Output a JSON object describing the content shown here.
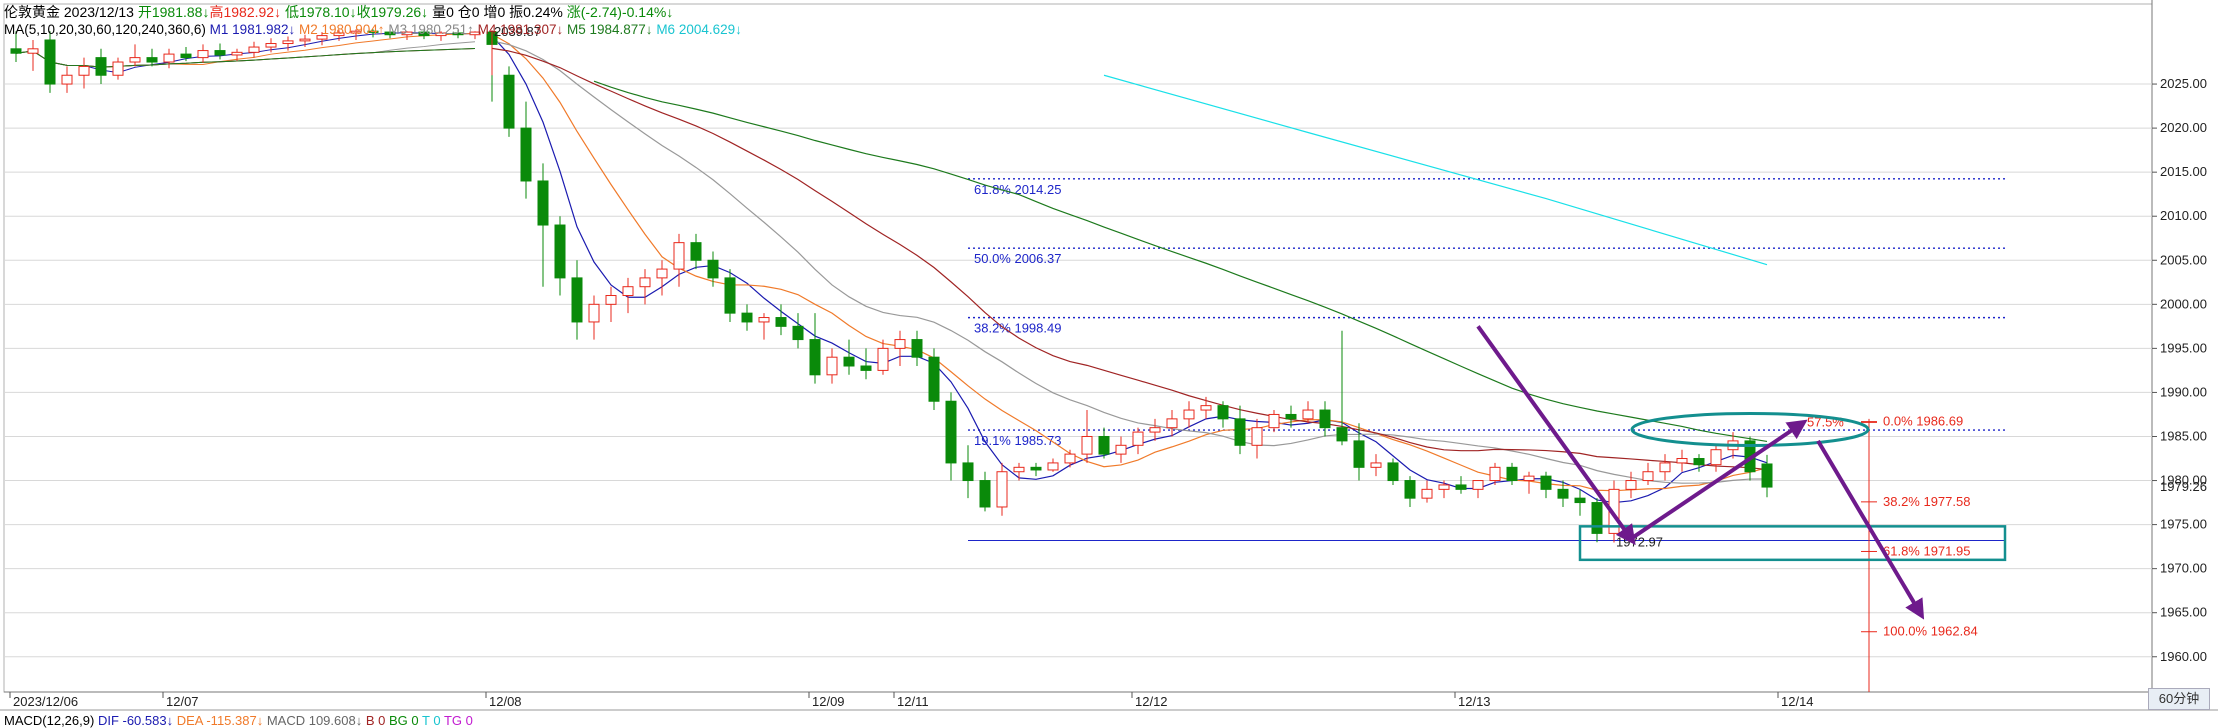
{
  "header": {
    "name": "伦敦黄金",
    "date": "2023/12/13",
    "open": "开1981.88↓",
    "high": "高1982.92↓",
    "low": "低1978.10↓",
    "close": "收1979.26↓",
    "vol": "量0",
    "oi": "仓0",
    "inc": "增0",
    "amp": "振0.24%",
    "chg": "涨(-2.74)-0.14%↓"
  },
  "ma_header": {
    "label": "MA(5,10,20,30,60,120,240,360,6)",
    "m1": "M1 1981.982↓",
    "m2": "M2 1980.904↑",
    "m3": "M3 1980.251↑",
    "m4": "M4 1981.307↓",
    "m5": "M5 1984.877↓",
    "m6": "M6 2004.629↓"
  },
  "macd_header": {
    "label": "MACD(12,26,9)",
    "dif": "DIF -60.583↓",
    "dea": "DEA -115.387↓",
    "macd": "MACD 109.608↓",
    "b": "B 0",
    "bg": "BG 0",
    "t": "T 0",
    "tg": "TG 0"
  },
  "period": "60分钟",
  "colors": {
    "up": "#e8291c",
    "down": "#0a8a0a",
    "fib": "#1d25c9",
    "m1": "#1b1bb0",
    "m2": "#f07a2a",
    "m3": "#999999",
    "m4": "#a02424",
    "m5": "#1d7a1d",
    "m6": "#19e0e8",
    "arrow": "#6e1a8c",
    "box": "#138f8f",
    "grid": "#d8d8d8"
  },
  "chart_data": {
    "type": "candlestick",
    "ylim": [
      1956,
      2030
    ],
    "y_ticks": [
      1960,
      1965,
      1970,
      1975,
      1980,
      1985,
      1990,
      1995,
      2000,
      2005,
      2010,
      2015,
      2020,
      2025
    ],
    "y_tick_labels": [
      "1960.00",
      "1965.00",
      "1970.00",
      "1975.00",
      "1980.00",
      "1985.00",
      "1990.00",
      "1995.00",
      "2000.00",
      "2005.00",
      "2010.00",
      "2015.00",
      "2020.00",
      "2025.00"
    ],
    "current_price": "1979.26",
    "x_labels": [
      {
        "label": "2023/12/06",
        "i": 0
      },
      {
        "label": "12/07",
        "i": 9
      },
      {
        "label": "12/08",
        "i": 28
      },
      {
        "label": "12/09",
        "i": 47
      },
      {
        "label": "12/11",
        "i": 52
      },
      {
        "label": "12/12",
        "i": 66
      },
      {
        "label": "12/13",
        "i": 85
      },
      {
        "label": "12/14",
        "i": 104
      }
    ],
    "candles": [
      [
        2029,
        2031,
        2027.5,
        2028.5
      ],
      [
        2028.5,
        2030,
        2026.5,
        2029
      ],
      [
        2030,
        2031,
        2024,
        2025
      ],
      [
        2025,
        2027,
        2024,
        2026
      ],
      [
        2026,
        2028,
        2024.5,
        2027
      ],
      [
        2028,
        2029,
        2025,
        2026
      ],
      [
        2026,
        2028,
        2025.5,
        2027.5
      ],
      [
        2027.5,
        2029.5,
        2027,
        2028
      ],
      [
        2028,
        2029,
        2027,
        2027.5
      ],
      [
        2027.5,
        2029,
        2026.8,
        2028.4
      ],
      [
        2028.4,
        2029.2,
        2027.6,
        2028
      ],
      [
        2028,
        2029.5,
        2027.4,
        2028.8
      ],
      [
        2028.8,
        2029.6,
        2027.8,
        2028.3
      ],
      [
        2028.3,
        2029,
        2027.6,
        2028.6
      ],
      [
        2028.6,
        2029.8,
        2028,
        2029.2
      ],
      [
        2029.2,
        2030.2,
        2028.6,
        2029.6
      ],
      [
        2029.6,
        2030.4,
        2028.8,
        2029.9
      ],
      [
        2029.9,
        2030.6,
        2029.2,
        2030.1
      ],
      [
        2030.1,
        2030.9,
        2029.4,
        2030.5
      ],
      [
        2030.5,
        2031.1,
        2029.9,
        2030.8
      ],
      [
        2030.8,
        2031.2,
        2030,
        2031
      ],
      [
        2031,
        2031.2,
        2030.3,
        2030.9
      ],
      [
        2030.9,
        2031.1,
        2030.2,
        2030.6
      ],
      [
        2030.6,
        2031,
        2030,
        2030.9
      ],
      [
        2030.9,
        2031.1,
        2030.1,
        2030.5
      ],
      [
        2030.5,
        2031,
        2029.9,
        2030.8
      ],
      [
        2030.8,
        2031.1,
        2030.2,
        2030.6
      ],
      [
        2030.6,
        2031,
        2030.1,
        2030.9
      ],
      [
        2030.9,
        2031,
        2023,
        2029.5
      ],
      [
        2026,
        2027,
        2019,
        2020
      ],
      [
        2020,
        2023,
        2012,
        2014
      ],
      [
        2014,
        2016,
        2002,
        2009
      ],
      [
        2009,
        2010,
        2001,
        2003
      ],
      [
        2003,
        2005,
        1996,
        1998
      ],
      [
        1998,
        2001,
        1996,
        2000
      ],
      [
        2000,
        2002,
        1998,
        2001
      ],
      [
        2001,
        2003,
        1999,
        2002
      ],
      [
        2002,
        2004,
        2000,
        2003
      ],
      [
        2003,
        2005,
        2001,
        2004
      ],
      [
        2004,
        2008,
        2002,
        2007
      ],
      [
        2007,
        2008,
        2004,
        2005
      ],
      [
        2005,
        2006,
        2002,
        2003
      ],
      [
        2003,
        2004,
        1998,
        1999
      ],
      [
        1999,
        2000,
        1997,
        1998
      ],
      [
        1998,
        1999,
        1996,
        1998.5
      ],
      [
        1998.5,
        2000,
        1996.5,
        1997.5
      ],
      [
        1997.5,
        1999,
        1995,
        1996
      ],
      [
        1996,
        1999,
        1991,
        1992
      ],
      [
        1992,
        1995,
        1991,
        1994
      ],
      [
        1994,
        1996,
        1992,
        1993
      ],
      [
        1993,
        1995,
        1991.5,
        1992.5
      ],
      [
        1992.5,
        1996,
        1992,
        1995
      ],
      [
        1995,
        1997,
        1993,
        1996
      ],
      [
        1996,
        1997,
        1993,
        1994
      ],
      [
        1994,
        1995,
        1988,
        1989
      ],
      [
        1989,
        1990,
        1980,
        1982
      ],
      [
        1982,
        1984,
        1978,
        1980
      ],
      [
        1980,
        1981,
        1976.5,
        1977
      ],
      [
        1977,
        1982,
        1976,
        1981
      ],
      [
        1981,
        1982,
        1980,
        1981.5
      ],
      [
        1981.5,
        1982,
        1980.5,
        1981.2
      ],
      [
        1981.2,
        1982.5,
        1981,
        1982
      ],
      [
        1982,
        1983.5,
        1981.5,
        1983
      ],
      [
        1983,
        1988,
        1982,
        1985
      ],
      [
        1985,
        1986,
        1982.5,
        1983
      ],
      [
        1983,
        1985,
        1982,
        1984
      ],
      [
        1984,
        1986,
        1983,
        1985.5
      ],
      [
        1985.5,
        1987,
        1984.5,
        1986
      ],
      [
        1986,
        1988,
        1985,
        1987
      ],
      [
        1987,
        1989,
        1986,
        1988
      ],
      [
        1988,
        1989.5,
        1987,
        1988.5
      ],
      [
        1988.5,
        1989,
        1986,
        1987
      ],
      [
        1987,
        1988.5,
        1983,
        1984
      ],
      [
        1984,
        1987,
        1982.5,
        1986
      ],
      [
        1986,
        1988,
        1985.5,
        1987.5
      ],
      [
        1987.5,
        1988.5,
        1986,
        1987
      ],
      [
        1987,
        1989,
        1986.5,
        1988
      ],
      [
        1988,
        1989,
        1985,
        1986
      ],
      [
        1986,
        1997,
        1984,
        1984.5
      ],
      [
        1984.5,
        1986.5,
        1980,
        1981.5
      ],
      [
        1981.5,
        1983,
        1980.5,
        1982
      ],
      [
        1982,
        1982.5,
        1979.5,
        1980
      ],
      [
        1980,
        1980.5,
        1977,
        1978
      ],
      [
        1978,
        1980,
        1977.5,
        1979
      ],
      [
        1979,
        1980,
        1978,
        1979.5
      ],
      [
        1979.5,
        1980.5,
        1978.5,
        1979
      ],
      [
        1979,
        1980,
        1978,
        1980
      ],
      [
        1980,
        1982,
        1979.5,
        1981.5
      ],
      [
        1981.5,
        1982,
        1979.5,
        1980
      ],
      [
        1980,
        1981,
        1978.5,
        1980.5
      ],
      [
        1980.5,
        1981,
        1978,
        1979
      ],
      [
        1979,
        1980,
        1977,
        1978
      ],
      [
        1978,
        1979,
        1976,
        1977.5
      ],
      [
        1977.5,
        1978,
        1973,
        1974
      ],
      [
        1974,
        1980,
        1972.97,
        1979
      ],
      [
        1979,
        1981,
        1978,
        1980
      ],
      [
        1980,
        1982,
        1979.5,
        1981
      ],
      [
        1981,
        1983,
        1980,
        1982
      ],
      [
        1982,
        1983.5,
        1981,
        1982.5
      ],
      [
        1982.5,
        1983,
        1981,
        1981.8
      ],
      [
        1981.8,
        1984,
        1981,
        1983.5
      ],
      [
        1983.5,
        1985.5,
        1982.5,
        1984.5
      ],
      [
        1984.5,
        1985,
        1980,
        1981
      ],
      [
        1981.88,
        1982.92,
        1978.1,
        1979.26
      ]
    ],
    "fib_levels": [
      {
        "label": "61.8% 2014.25",
        "value": 2014.25
      },
      {
        "label": "50.0% 2006.37",
        "value": 2006.37
      },
      {
        "label": "38.2% 1998.49",
        "value": 1998.49
      },
      {
        "label": "19.1% 1985.73",
        "value": 1985.73
      }
    ],
    "projection_levels": [
      {
        "label": "57.5%",
        "value": 1986.6
      },
      {
        "label": "0.0% 1986.69",
        "value": 1986.69
      },
      {
        "label": "38.2% 1977.58",
        "value": 1977.58
      },
      {
        "label": "61.8% 1971.95",
        "value": 1971.95
      },
      {
        "label": "100.0% 1962.84",
        "value": 1962.84
      }
    ],
    "annotations": [
      {
        "label": "2039.87",
        "i": 28,
        "value": 2039.87
      },
      {
        "label": "1972.97",
        "i": 94,
        "value": 1972.97
      }
    ],
    "support_line": 1973.2
  }
}
